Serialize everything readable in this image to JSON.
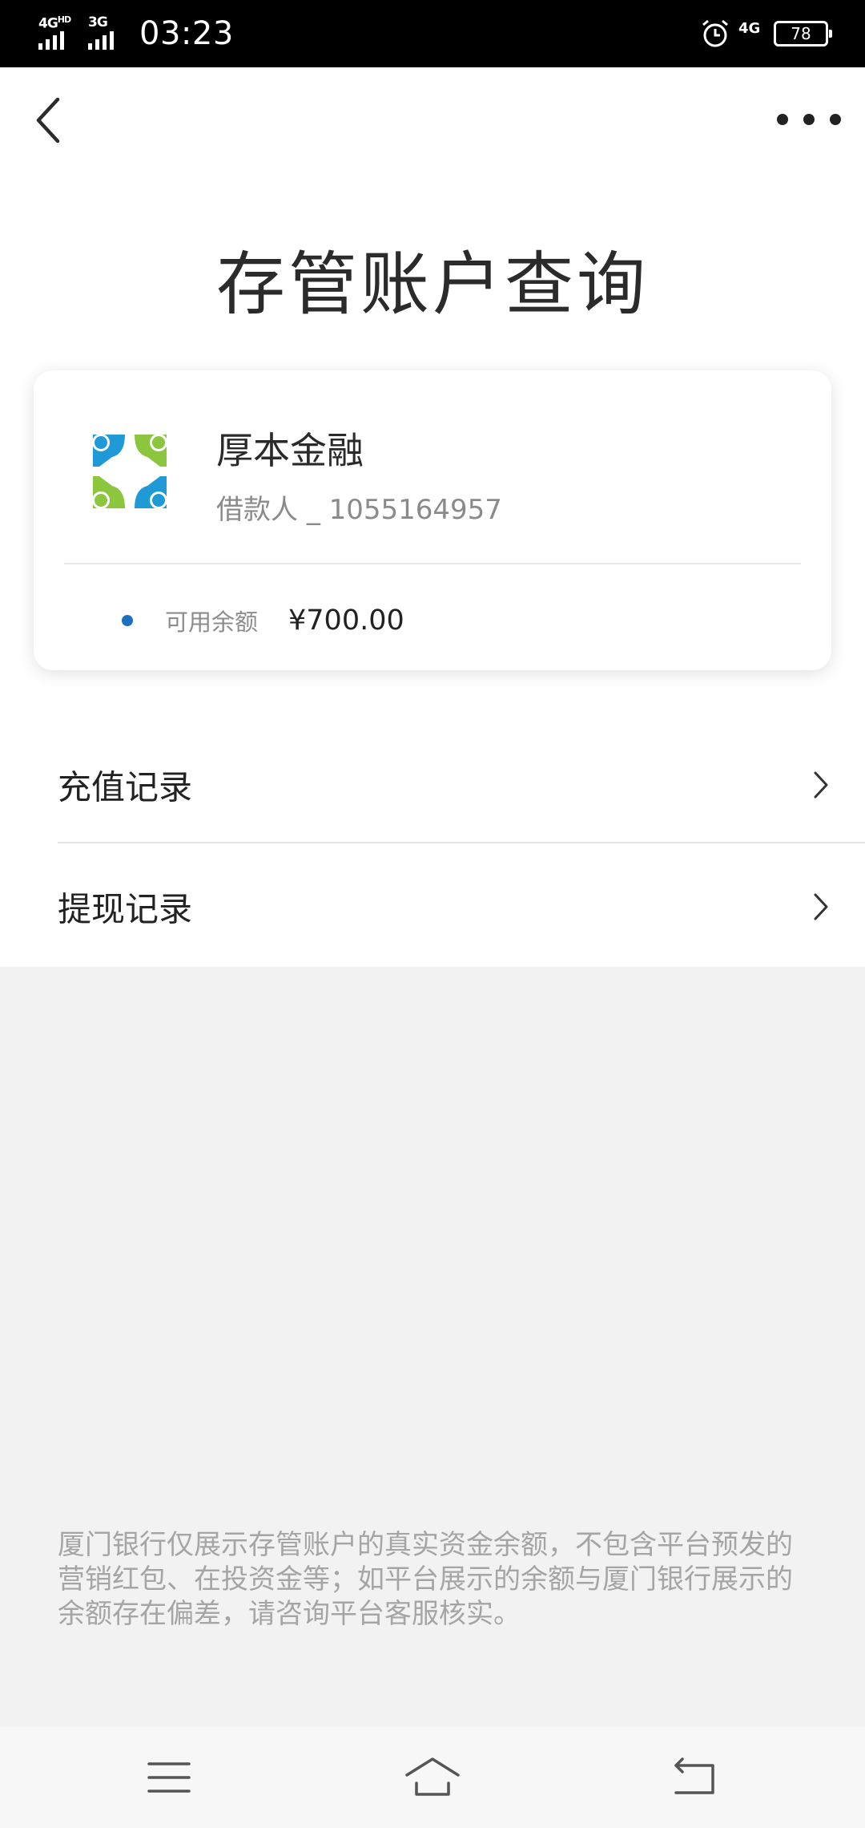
{
  "status_bar": {
    "net1": "4G",
    "net1_sup": "HD",
    "net2": "3G",
    "time": "03:23",
    "net_right": "4G",
    "battery": "78"
  },
  "header": {
    "title": "存管账户查询"
  },
  "account": {
    "org_name": "厚本金融",
    "role": "借款人",
    "separator": "_",
    "account_number": "1055164957",
    "balance_label": "可用余额",
    "balance_value": "¥700.00"
  },
  "menu": {
    "items": [
      {
        "label": "充值记录"
      },
      {
        "label": "提现记录"
      }
    ]
  },
  "notice": "厦门银行仅展示存管账户的真实资金余额，不包含平台预发的营销红包、在投资金等；如平台展示的余额与厦门银行展示的余额存在偏差，请咨询平台客服核实。",
  "colors": {
    "accent_dot": "#1d6fc1",
    "logo_blue": "#1f9ad6",
    "logo_green": "#8cc63e"
  },
  "icons": {
    "back": "chevron-left-icon",
    "more": "more-dots-icon",
    "row_arrow": "chevron-right-icon",
    "nav_menu": "menu-icon",
    "nav_home": "home-icon",
    "nav_back": "back-icon"
  }
}
